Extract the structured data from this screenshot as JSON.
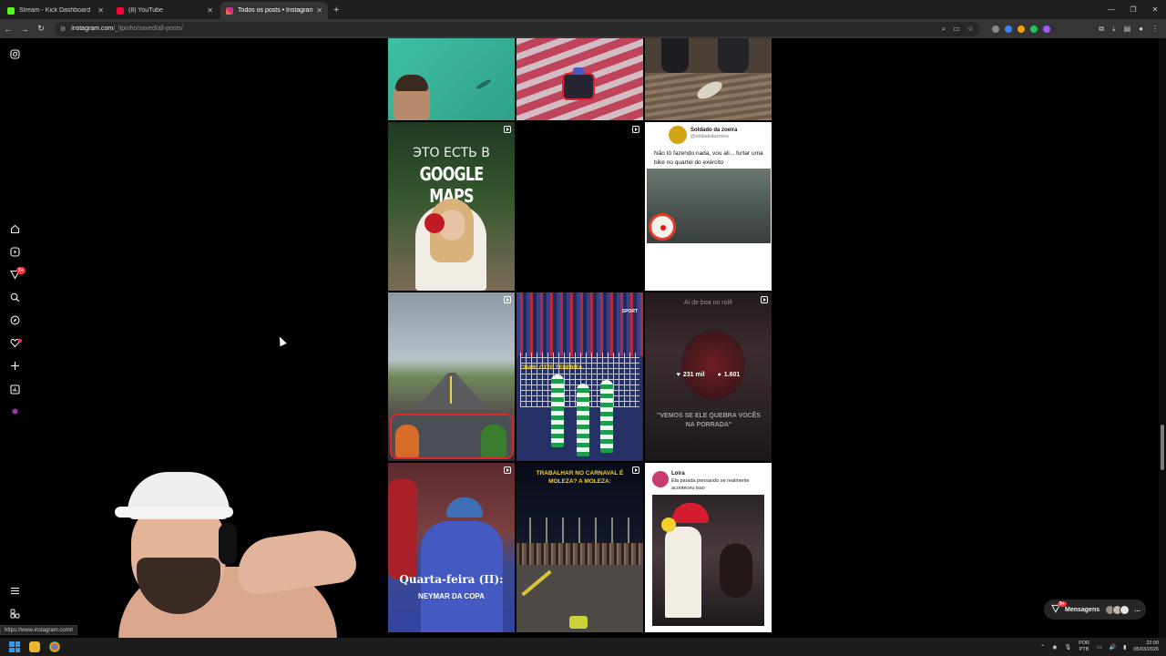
{
  "browser": {
    "tabs": [
      {
        "title": "Stream - Kick Dashboard",
        "favicon_color": "#53fc18",
        "active": false
      },
      {
        "title": "(8) YouTube",
        "favicon_color": "#ff0033",
        "active": false
      },
      {
        "title": "Todos os posts • Instagram",
        "favicon_color": "#e1306c",
        "active": true
      }
    ],
    "new_tab": "+",
    "address": {
      "host": "instagram.com",
      "path": "/_lipinho/saved/all-posts/"
    }
  },
  "grid": {
    "post_4": {
      "line1": "ЭТО ЕСТЬ В",
      "line2": "GOOGLE MAPS"
    },
    "post_6": {
      "name": "Soldado da zoeira",
      "handle": "@soldadodazoeira",
      "text": "Não tô fazendo nada, vou ali... furtar uma bike no quartel do exército"
    },
    "post_8": {
      "tag": "CHARLOTTE TENERIFA",
      "tag2": "SPORT"
    },
    "post_9": {
      "top": "Ai de boa no rolê",
      "likes": "231 mil",
      "comments": "1.601",
      "bottom": "\"VEMOS SE ELE QUEBRA VOCÊS NA PORRADA\""
    },
    "post_10": {
      "title": "Quarta-feira (II):",
      "subtitle": "NEYMAR DA COPA"
    },
    "post_11": {
      "headline": "TRABALHAR NO CARNAVAL É MOLEZA? A MOLEZA:"
    },
    "post_12": {
      "name": "Loira",
      "text": "Ela parada pensando se realmente aconteceu isso"
    }
  },
  "messages": {
    "label": "Mensagens",
    "badge": "9+"
  },
  "notification_badge": "9+",
  "status_url": "https://www.instagram.com/r",
  "taskbar": {
    "lang_1": "POR",
    "lang_2": "PTB",
    "time": "22:00",
    "date": "05/03/2026"
  },
  "colors": {
    "accent_badge": "#ff3040",
    "chrome_bg": "#1f1f1f",
    "toolbar_bg": "#353535"
  }
}
